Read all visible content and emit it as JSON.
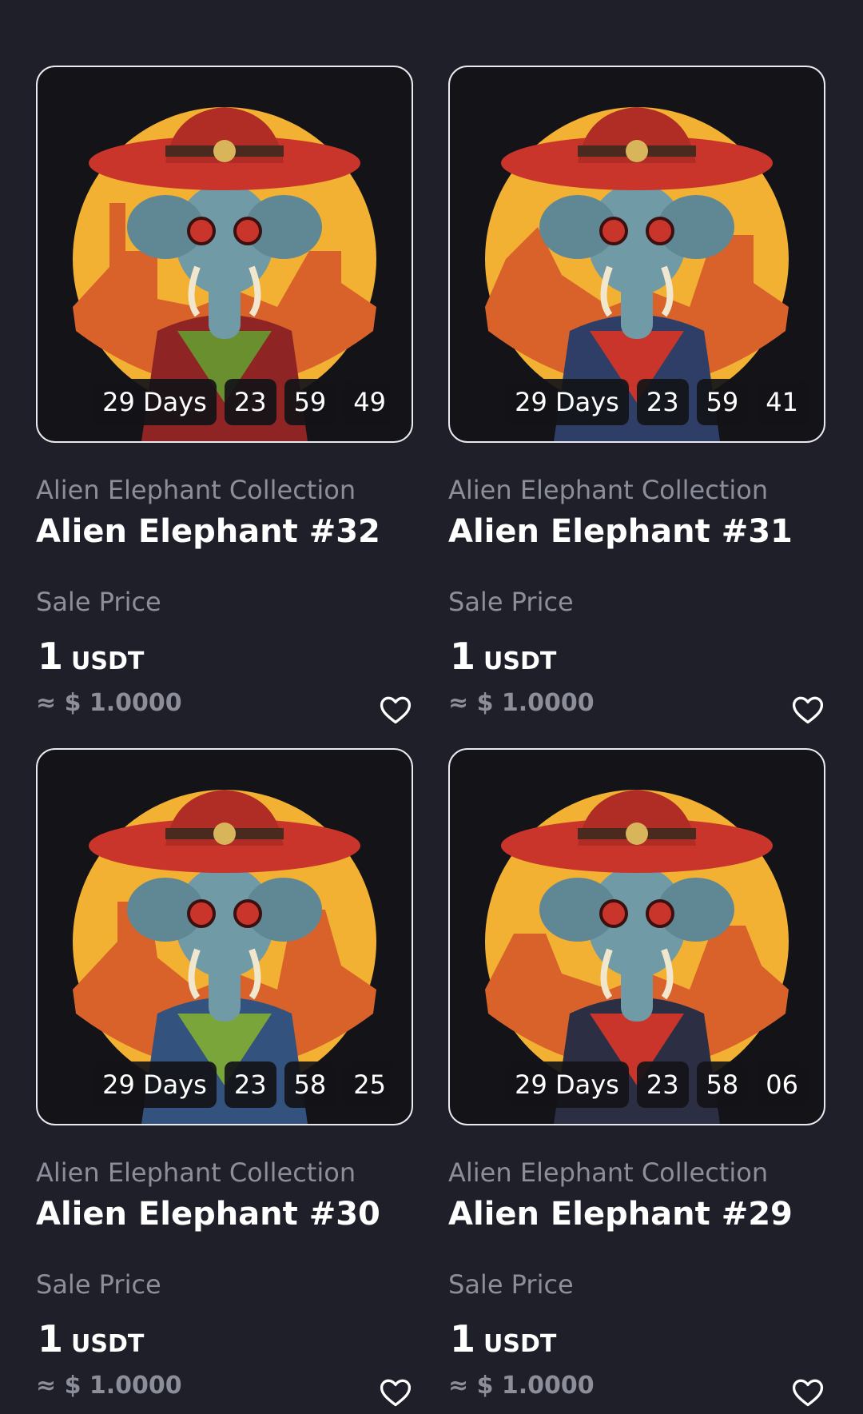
{
  "colors": {
    "background": "#1e1f29",
    "muted_text": "#8c8e99",
    "card_border": "#e9e9ef",
    "sun": "#f2b133",
    "hat": "#c9352b",
    "skin": "#6f9aa6"
  },
  "cards": [
    {
      "countdown": {
        "days": "29 Days",
        "hours": "23",
        "minutes": "59",
        "seconds": "49"
      },
      "collection": "Alien Elephant Collection",
      "name": "Alien Elephant #32",
      "sale_label": "Sale Price",
      "price_value": "1",
      "price_unit": "USDT",
      "usd_value": "≈ $ 1.0000",
      "favorite_icon": "heart-outline-icon"
    },
    {
      "countdown": {
        "days": "29 Days",
        "hours": "23",
        "minutes": "59",
        "seconds": "41"
      },
      "collection": "Alien Elephant Collection",
      "name": "Alien Elephant #31",
      "sale_label": "Sale Price",
      "price_value": "1",
      "price_unit": "USDT",
      "usd_value": "≈ $ 1.0000",
      "favorite_icon": "heart-outline-icon"
    },
    {
      "countdown": {
        "days": "29 Days",
        "hours": "23",
        "minutes": "58",
        "seconds": "25"
      },
      "collection": "Alien Elephant Collection",
      "name": "Alien Elephant #30",
      "sale_label": "Sale Price",
      "price_value": "1",
      "price_unit": "USDT",
      "usd_value": "≈ $ 1.0000",
      "favorite_icon": "heart-outline-icon"
    },
    {
      "countdown": {
        "days": "29 Days",
        "hours": "23",
        "minutes": "58",
        "seconds": "06"
      },
      "collection": "Alien Elephant Collection",
      "name": "Alien Elephant #29",
      "sale_label": "Sale Price",
      "price_value": "1",
      "price_unit": "USDT",
      "usd_value": "≈ $ 1.0000",
      "favorite_icon": "heart-outline-icon"
    }
  ]
}
